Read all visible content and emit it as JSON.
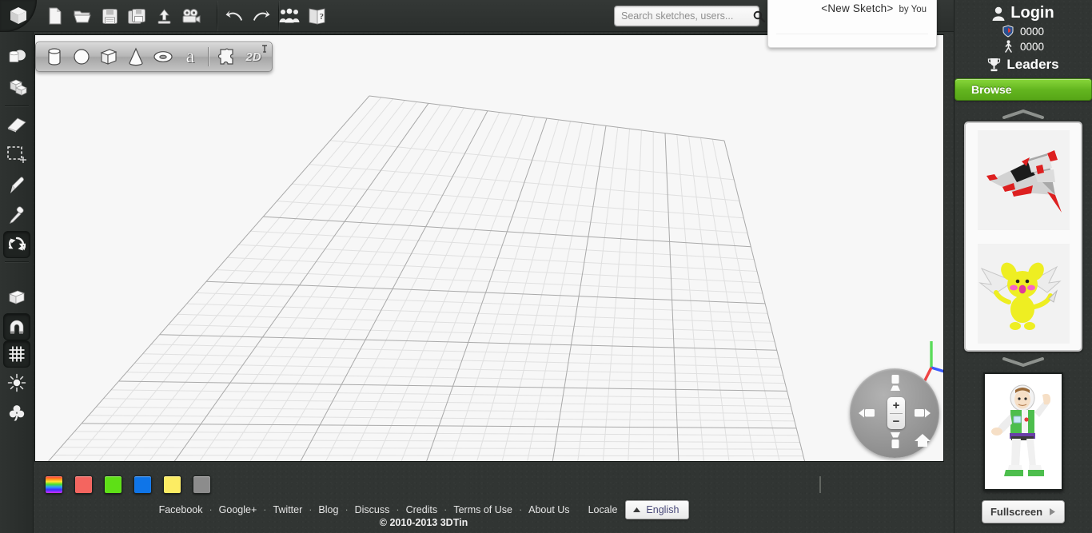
{
  "app": {
    "logo_icon": "cube-logo-icon",
    "copyright": "© 2010-2013 3DTin"
  },
  "toolbar": {
    "items": [
      {
        "name": "new-file-button",
        "icon": "new-file-icon",
        "label": "New"
      },
      {
        "name": "open-file-button",
        "icon": "open-folder-icon",
        "label": "Open"
      },
      {
        "name": "save-button",
        "icon": "floppy-disk-icon",
        "label": "Save"
      },
      {
        "name": "save-as-button",
        "icon": "floppy-copy-icon",
        "label": "Save As"
      },
      {
        "name": "export-button",
        "icon": "upload-icon",
        "label": "Export"
      },
      {
        "name": "record-button",
        "icon": "movie-camera-icon",
        "label": "Record"
      },
      {
        "name": "undo-button",
        "icon": "undo-arrow-icon",
        "label": "Undo"
      },
      {
        "name": "redo-button",
        "icon": "redo-arrow-icon",
        "label": "Redo"
      },
      {
        "name": "community-button",
        "icon": "people-group-icon",
        "label": "Community"
      },
      {
        "name": "help-button",
        "icon": "help-book-icon",
        "label": "Help"
      }
    ]
  },
  "search": {
    "placeholder": "Search sketches, users...",
    "value": "",
    "icon": "magnifier-icon"
  },
  "sketch_popup": {
    "title": "<New Sketch>",
    "author": "by You"
  },
  "left_rail": {
    "items": [
      {
        "name": "tool-rotate-copy",
        "icon": "rotate-duplicate-icon",
        "active": false
      },
      {
        "name": "tool-stack-blocks",
        "icon": "stacked-blocks-icon",
        "active": false
      },
      {
        "name": "tool-eraser",
        "icon": "eraser-icon",
        "active": false
      },
      {
        "name": "tool-select-region",
        "icon": "marquee-select-icon",
        "active": false
      },
      {
        "name": "tool-paint-brush",
        "icon": "paint-brush-icon",
        "active": false
      },
      {
        "name": "tool-eyedropper",
        "icon": "eyedropper-icon",
        "active": false
      },
      {
        "name": "tool-refresh",
        "icon": "refresh-sync-icon",
        "active": true
      },
      {
        "name": "tool-single-block",
        "icon": "single-cube-icon",
        "active": false
      },
      {
        "name": "tool-snap-magnet",
        "icon": "magnet-icon",
        "active": true
      },
      {
        "name": "tool-grid-toggle",
        "icon": "grid-icon",
        "active": true
      },
      {
        "name": "tool-brightness",
        "icon": "sun-brightness-icon",
        "active": false
      },
      {
        "name": "tool-clover",
        "icon": "clover-icon",
        "active": false
      }
    ]
  },
  "shape_toolbar": {
    "items": [
      {
        "name": "shape-cylinder",
        "icon": "cylinder-icon",
        "label": "Cylinder"
      },
      {
        "name": "shape-sphere",
        "icon": "sphere-icon",
        "label": "Sphere"
      },
      {
        "name": "shape-box",
        "icon": "box-icon",
        "label": "Box"
      },
      {
        "name": "shape-cone",
        "icon": "cone-icon",
        "label": "Cone"
      },
      {
        "name": "shape-torus",
        "icon": "torus-icon",
        "label": "Torus"
      },
      {
        "name": "shape-text",
        "icon": "text-letter-icon",
        "label": "a"
      },
      {
        "name": "shape-plugin",
        "icon": "puzzle-piece-icon",
        "label": "Plugin"
      },
      {
        "name": "shape-2d",
        "icon": "two-d-icon",
        "label": "2D"
      }
    ],
    "pin_icon": "pushpin-icon"
  },
  "viewport": {
    "axis": {
      "x_color": "#ef4444",
      "y_color": "#5bdc5b",
      "z_color": "#3b5bfd"
    },
    "grid": {
      "minor_color": "#e3e3e3",
      "major_color": "#a8a8a8",
      "background": "#f7f7f7"
    },
    "nav_pad": {
      "zoom_in": "+",
      "zoom_out": "−",
      "buttons": [
        {
          "name": "nav-camera-up",
          "icon": "camera-up-icon"
        },
        {
          "name": "nav-camera-down",
          "icon": "camera-down-icon"
        },
        {
          "name": "nav-camera-left",
          "icon": "camera-left-icon"
        },
        {
          "name": "nav-camera-right",
          "icon": "camera-right-icon"
        },
        {
          "name": "nav-home",
          "icon": "home-icon"
        }
      ]
    }
  },
  "palette": {
    "swatches": [
      {
        "name": "color-swatch-rainbow",
        "color": "rainbow"
      },
      {
        "name": "color-swatch-red",
        "color": "#f4655f"
      },
      {
        "name": "color-swatch-green",
        "color": "#5ee016"
      },
      {
        "name": "color-swatch-blue",
        "color": "#0f75e8"
      },
      {
        "name": "color-swatch-yellow",
        "color": "#fcec63"
      },
      {
        "name": "color-swatch-gray",
        "color": "#8c8c8c"
      }
    ]
  },
  "footer": {
    "links": [
      "Facebook",
      "Google+",
      "Twitter",
      "Blog",
      "Discuss",
      "Credits",
      "Terms of Use",
      "About Us"
    ],
    "separator": "·",
    "locale_label": "Locale",
    "language": "English",
    "language_caret_icon": "caret-up-icon"
  },
  "sidebar": {
    "login_label": "Login",
    "login_icon": "user-silhouette-icon",
    "stats": [
      {
        "name": "stat-badge-count",
        "icon": "shield-badge-icon",
        "value": "0000"
      },
      {
        "name": "stat-person-count",
        "icon": "walking-person-icon",
        "value": "0000"
      }
    ],
    "leaders_label": "Leaders",
    "leaders_icon": "trophy-icon",
    "browse_label": "Browse",
    "browse_color": "#63b51f",
    "scroll_up_icon": "chevron-up-icon",
    "scroll_down_icon": "chevron-down-icon",
    "gallery": [
      {
        "name": "gallery-thumb-spaceship",
        "alt": "red and gray spaceship model"
      },
      {
        "name": "gallery-thumb-creature",
        "alt": "yellow winged creature model"
      }
    ],
    "featured": {
      "name": "featured-thumb-figure",
      "alt": "space ranger action figure"
    },
    "fullscreen_label": "Fullscreen",
    "fullscreen_icon": "play-triangle-icon"
  }
}
